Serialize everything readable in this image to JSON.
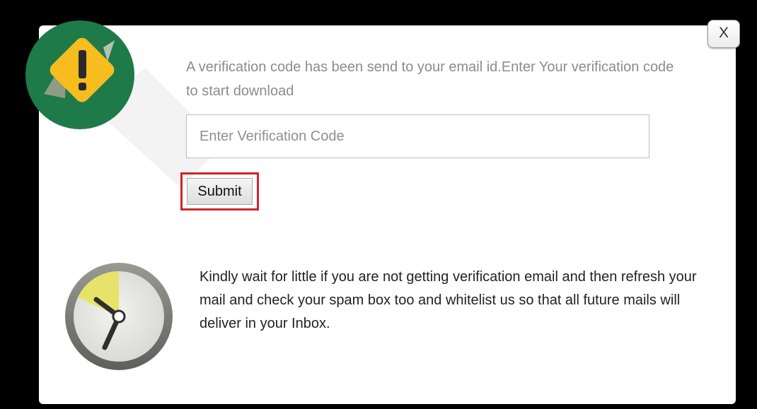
{
  "dialog": {
    "close_label": "X",
    "message": "A verification code has been send to your email id.Enter Your verification code to start download",
    "code_input": {
      "placeholder": "Enter Verification Code",
      "value": ""
    },
    "submit_label": "Submit",
    "note": "Kindly wait for little if you are not getting verification email and then refresh your mail and check your spam box too and whitelist us so that all future mails will deliver in your Inbox."
  },
  "icons": {
    "warning": "warning-icon",
    "clock": "clock-icon",
    "close": "close-icon"
  },
  "colors": {
    "backdrop": "#000000",
    "dialog_bg": "#ffffff",
    "badge_green": "#1f7a4a",
    "warning_yellow": "#f7bd1f",
    "highlight_red": "#d2232a",
    "clock_wedge": "#e7e36a"
  }
}
